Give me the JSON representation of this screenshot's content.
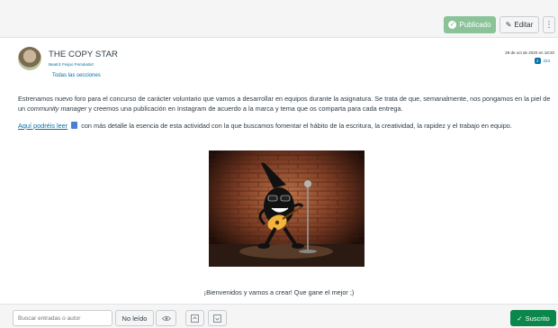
{
  "toolbar": {
    "published_label": "Publicado",
    "edit_label": "Editar",
    "more_icon": "⋮",
    "published_color": "#8bc399"
  },
  "post": {
    "title": "THE COPY STAR",
    "author": "Beatriz Feijoo Fernández",
    "sections": "Todas las secciones",
    "date": "29 de oct de 2020 en 18:20",
    "reply_badge": "2",
    "reply_count": "224",
    "paragraph1": "Estrenamos nuevo foro para el concurso de carácter voluntario que vamos a desarrollar en equipos durante la asignatura. Se trata de que, semanalmente, nos pongamos en la piel de un ",
    "paragraph1_em": "community manager",
    "paragraph1_end": " y creemos una publicación en Instagram de acuerdo a la marca y tema que os comparta para cada entrega.",
    "link_text": "Aquí podréis leer",
    "paragraph2": " con más detalle la esencia de esta actividad con la que buscamos fomentar el hábito de la escritura, la creatividad, la rapidez y el trabajo en equipo.",
    "caption": "¡Bienvenidos y vamos a crear! Que gane el mejor ;)"
  },
  "bottom": {
    "search_placeholder": "Buscar entradas o autor",
    "unread_label": "No leído",
    "subscribed_label": "Suscrito",
    "subscribed_color": "#0b874b"
  }
}
